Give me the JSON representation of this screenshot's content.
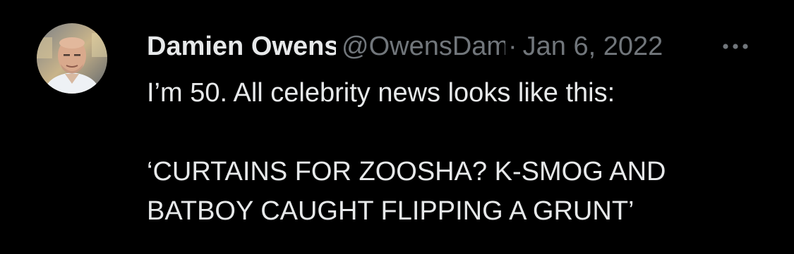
{
  "tweet": {
    "author": {
      "display_name": "Damien Owens",
      "handle": "@OwensDamien",
      "avatar_icon": "profile-photo"
    },
    "separator": "·",
    "date": "Jan 6, 2022",
    "more_icon": "ellipsis-icon",
    "text_lines": [
      "I’m 50. All celebrity news looks like this:",
      "‘CURTAINS FOR ZOOSHA? K-SMOG AND",
      "BATBOY CAUGHT FLIPPING A GRUNT’"
    ]
  },
  "colors": {
    "background": "#000000",
    "primary_text": "#e7e9ea",
    "secondary_text": "#71767b"
  }
}
